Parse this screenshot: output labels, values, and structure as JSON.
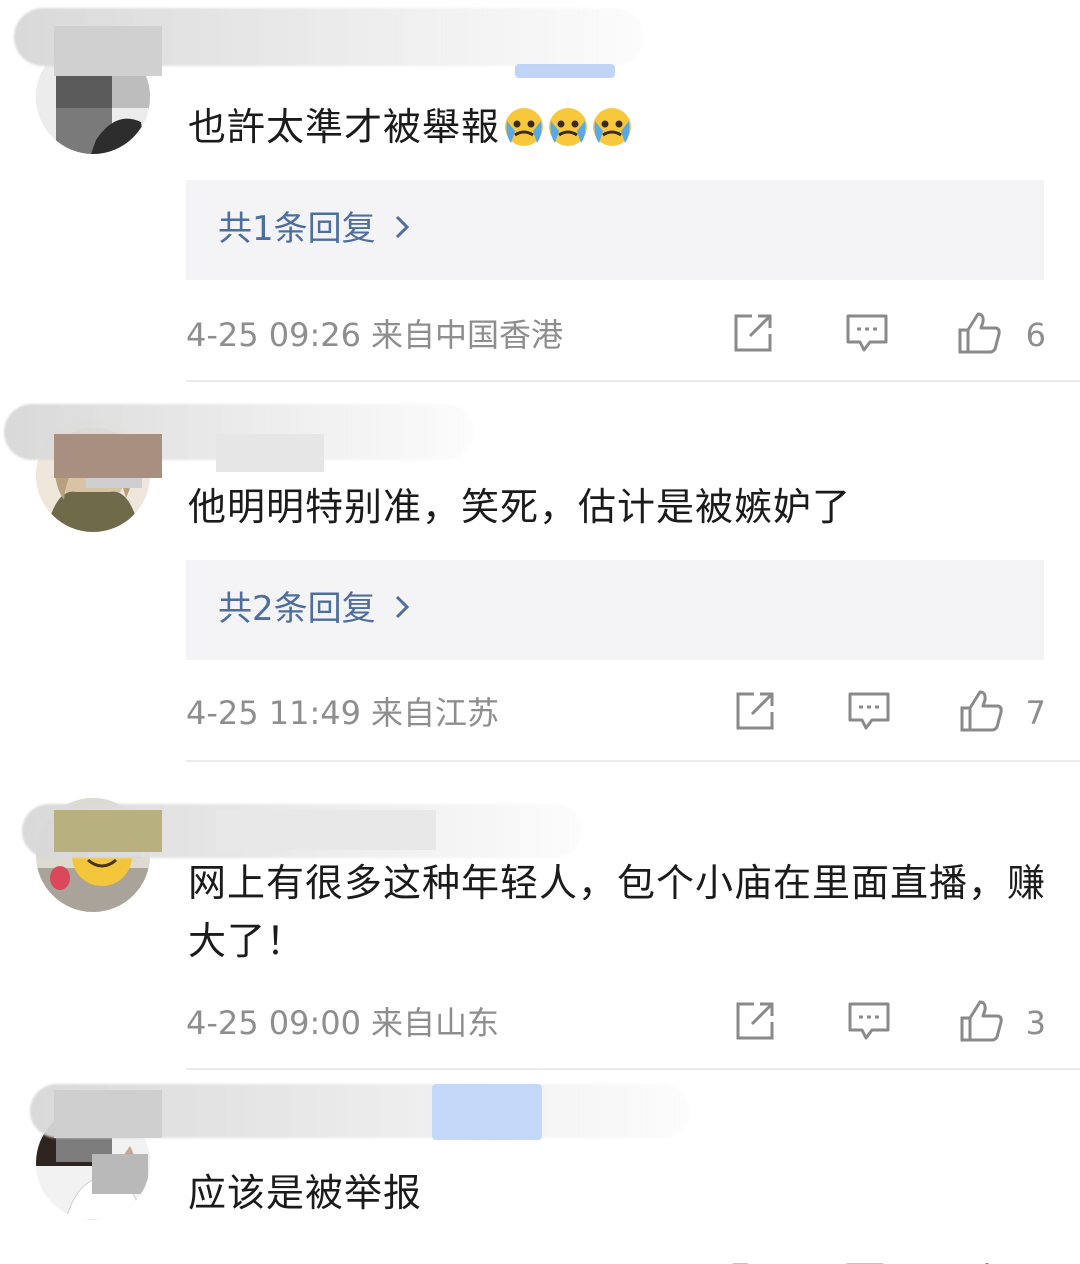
{
  "comments": [
    {
      "text": "也許太準才被舉報",
      "emoji": [
        "crying-face-emoji",
        "crying-face-emoji",
        "crying-face-emoji"
      ],
      "reply_label": "共1条回复",
      "time": "4-25 09:26",
      "location": "来自中国香港",
      "likes": "6"
    },
    {
      "text": "他明明特别准，笑死，估计是被嫉妒了",
      "reply_label": "共2条回复",
      "time": "4-25 11:49",
      "location": "来自江苏",
      "likes": "7"
    },
    {
      "text": "网上有很多这种年轻人，包个小庙在里面直播，赚大了！",
      "time": "4-25 09:00",
      "location": "来自山东",
      "likes": "3"
    },
    {
      "text": "应该是被举报"
    }
  ],
  "icons": {
    "share": "share-icon",
    "comment": "comment-icon",
    "like": "thumbs-up-icon",
    "reply_arrow": "chevron-right-icon"
  },
  "colors": {
    "link": "#4e6e9e",
    "meta": "#8e8e8e",
    "reply_bg": "#f4f4f6",
    "divider": "#ebebeb"
  }
}
